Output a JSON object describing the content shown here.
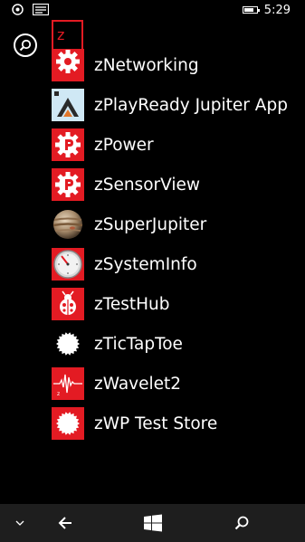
{
  "status_bar": {
    "time": "5:29",
    "battery_level": 0.75,
    "icons": [
      "data-saver-icon",
      "message-icon"
    ]
  },
  "header": {
    "jump_letter": "z",
    "search_icon": "search-icon"
  },
  "apps": [
    {
      "label": "zNetworking",
      "icon": "gear-cog-icon"
    },
    {
      "label": "zPlayReady Jupiter App",
      "icon": "playready-triangle-icon"
    },
    {
      "label": "zPower",
      "icon": "power-p-gear-icon"
    },
    {
      "label": "zSensorView",
      "icon": "sensor-p-gear-icon"
    },
    {
      "label": "zSuperJupiter",
      "icon": "jupiter-planet-icon"
    },
    {
      "label": "zSystemInfo",
      "icon": "gauge-dial-icon"
    },
    {
      "label": "zTestHub",
      "icon": "ladybug-icon"
    },
    {
      "label": "zTicTapToe",
      "icon": "starburst-icon"
    },
    {
      "label": "zWavelet2",
      "icon": "waveform-icon"
    },
    {
      "label": "zWP Test Store",
      "icon": "starburst-icon"
    }
  ],
  "app_bar": {
    "buttons": [
      "chevron-down-icon",
      "back-arrow-icon",
      "windows-logo-icon",
      "search-icon"
    ]
  },
  "colors": {
    "accent": "#e31b23",
    "background": "#000000",
    "app_bar": "#1e1e1e"
  }
}
